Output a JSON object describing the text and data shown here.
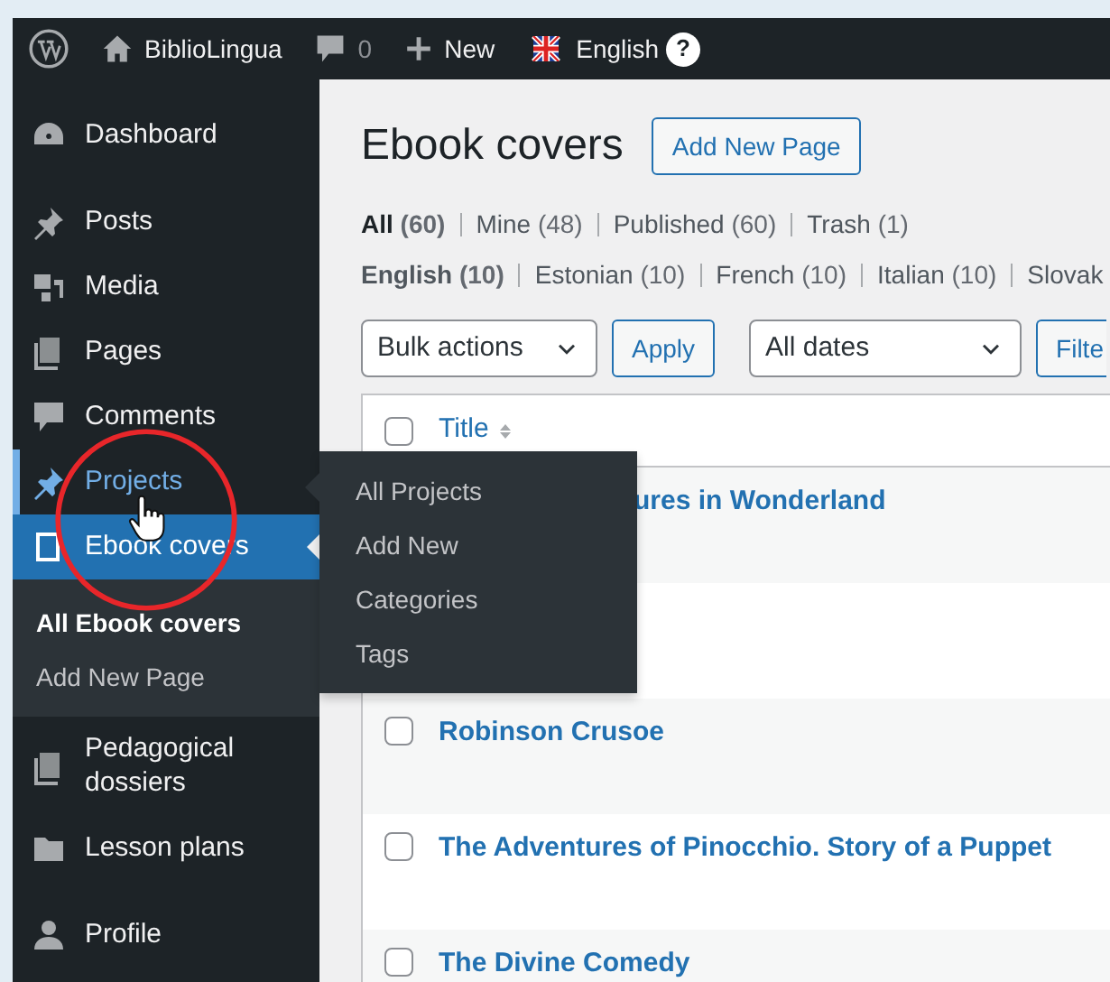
{
  "admin_bar": {
    "site_name": "BiblioLingua",
    "comments_count": "0",
    "new_label": "New",
    "language": "English",
    "help": "?"
  },
  "sidebar": {
    "groups": [
      {
        "items": [
          {
            "label": "Dashboard",
            "highlighted": false,
            "selected": false
          }
        ]
      },
      {
        "items": [
          {
            "label": "Posts",
            "highlighted": false,
            "selected": false
          },
          {
            "label": "Media",
            "highlighted": false,
            "selected": false
          },
          {
            "label": "Pages",
            "highlighted": false,
            "selected": false
          },
          {
            "label": "Comments",
            "highlighted": false,
            "selected": false
          },
          {
            "label": "Projects",
            "highlighted": true,
            "selected": false
          },
          {
            "label": "Ebook covers",
            "highlighted": false,
            "selected": true,
            "submenu": [
              {
                "label": "All Ebook covers",
                "selected": true
              },
              {
                "label": "Add New Page",
                "selected": false
              }
            ]
          },
          {
            "label": "Pedagogical dossiers",
            "highlighted": false,
            "selected": false
          },
          {
            "label": "Lesson plans",
            "highlighted": false,
            "selected": false
          }
        ]
      },
      {
        "items": [
          {
            "label": "Profile",
            "highlighted": false,
            "selected": false
          }
        ]
      }
    ]
  },
  "flyout_menu": {
    "items": [
      "All Projects",
      "Add New",
      "Categories",
      "Tags"
    ]
  },
  "page": {
    "title": "Ebook covers",
    "add_button": "Add New Page",
    "status_filters": [
      {
        "label": "All",
        "count": "(60)",
        "selected": true
      },
      {
        "label": "Mine",
        "count": "(48)",
        "selected": false
      },
      {
        "label": "Published",
        "count": "(60)",
        "selected": false
      },
      {
        "label": "Trash",
        "count": "(1)",
        "selected": false
      }
    ],
    "language_filters": [
      {
        "label": "English",
        "count": "(10)",
        "selected": true
      },
      {
        "label": "Estonian",
        "count": "(10)",
        "selected": false
      },
      {
        "label": "French",
        "count": "(10)",
        "selected": false
      },
      {
        "label": "Italian",
        "count": "(10)",
        "selected": false
      },
      {
        "label": "Slovak",
        "selected": false
      }
    ],
    "bulk_actions": "Bulk actions",
    "apply": "Apply",
    "dates": "All dates",
    "filter": "Filte",
    "table": {
      "select_all_checked": false,
      "columns": [
        "Title"
      ],
      "rows": [
        {
          "title": "ures in Wonderland",
          "partly_hidden": true
        },
        {},
        {
          "title": "Robinson Crusoe",
          "partly_hidden": false,
          "checked": false
        },
        {
          "title": "The Adventures of Pinocchio. Story of a Puppet",
          "partly_hidden": false,
          "checked": false
        },
        {
          "title": "The Divine Comedy",
          "partly_hidden": false,
          "checked": false
        }
      ]
    }
  }
}
